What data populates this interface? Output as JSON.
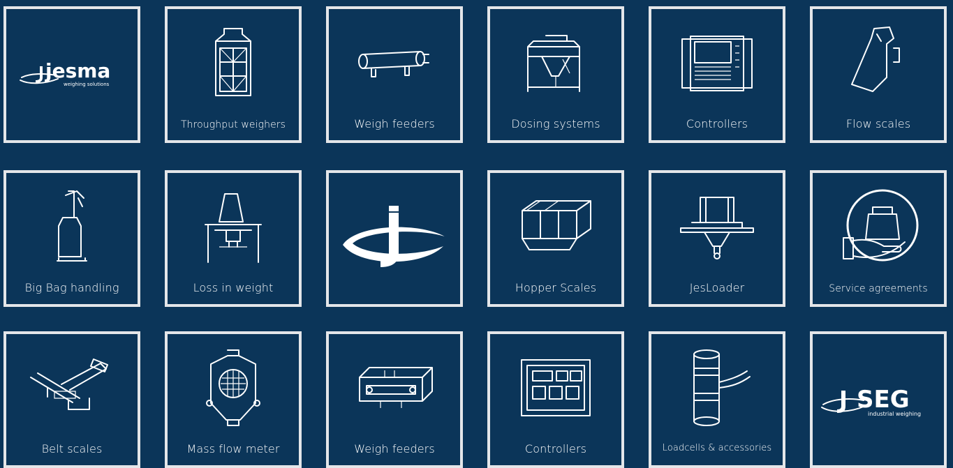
{
  "colors": {
    "background": "#0b3559",
    "tile_border": "#e4e6e9",
    "text": "#ffffff"
  },
  "tiles": [
    {
      "row": 0,
      "col": 0,
      "label": "",
      "icon": "jesma-logo",
      "logo_text": "jesma",
      "logo_sub": "weighing solutions"
    },
    {
      "row": 0,
      "col": 1,
      "label": "Throughput weighers",
      "icon": "throughput-weigher-icon"
    },
    {
      "row": 0,
      "col": 2,
      "label": "Weigh feeders",
      "icon": "weigh-feeder-icon"
    },
    {
      "row": 0,
      "col": 3,
      "label": "Dosing systems",
      "icon": "dosing-system-icon"
    },
    {
      "row": 0,
      "col": 4,
      "label": "Controllers",
      "icon": "controller-icon"
    },
    {
      "row": 0,
      "col": 5,
      "label": "Flow scales",
      "icon": "flow-scale-icon"
    },
    {
      "row": 1,
      "col": 0,
      "label": "Big Bag handling",
      "icon": "big-bag-icon"
    },
    {
      "row": 1,
      "col": 1,
      "label": "Loss in weight",
      "icon": "loss-in-weight-icon"
    },
    {
      "row": 1,
      "col": 2,
      "label": "",
      "icon": "j-emblem-icon"
    },
    {
      "row": 1,
      "col": 3,
      "label": "Hopper Scales",
      "icon": "hopper-scale-icon"
    },
    {
      "row": 1,
      "col": 4,
      "label": "JesLoader",
      "icon": "jesloader-icon"
    },
    {
      "row": 1,
      "col": 5,
      "label": "Service agreements",
      "icon": "service-agreement-icon"
    },
    {
      "row": 2,
      "col": 0,
      "label": "Belt scales",
      "icon": "belt-scale-icon"
    },
    {
      "row": 2,
      "col": 1,
      "label": "Mass flow meter",
      "icon": "mass-flow-meter-icon"
    },
    {
      "row": 2,
      "col": 2,
      "label": "Weigh feeders",
      "icon": "weigh-feeder-box-icon"
    },
    {
      "row": 2,
      "col": 3,
      "label": "Controllers",
      "icon": "controller-panel-icon"
    },
    {
      "row": 2,
      "col": 4,
      "label": "Loadcells & accessories",
      "icon": "loadcell-icon"
    },
    {
      "row": 2,
      "col": 5,
      "label": "",
      "icon": "seg-logo",
      "logo_text": "SEG",
      "logo_sub": "industrial weighing"
    }
  ]
}
